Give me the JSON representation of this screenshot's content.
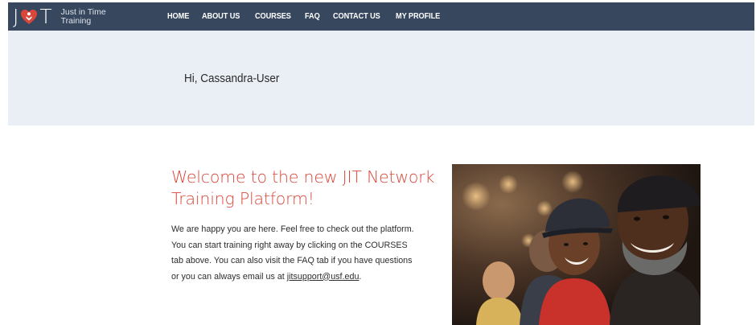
{
  "brand": {
    "logo_letter_left": "J",
    "logo_letter_right": "T",
    "name_line1": "Just in Time",
    "name_line2": "Training"
  },
  "nav": {
    "items": [
      {
        "label": "HOME"
      },
      {
        "label": "ABOUT US"
      },
      {
        "label": "COURSES"
      },
      {
        "label": "FAQ"
      },
      {
        "label": "CONTACT US"
      },
      {
        "label": "MY PROFILE"
      }
    ]
  },
  "greeting": "Hi, Cassandra-User",
  "welcome": {
    "title": "Welcome to the new JIT Network Training Platform!",
    "body_before_link": "We are happy you are here. Feel free to check out the platform. You can start training right away by clicking on the COURSES tab above. You can also visit the FAQ tab if you have questions or you can always email us at ",
    "email": "jitsupport@usf.edu",
    "body_after_link": "."
  },
  "colors": {
    "nav_background": "#36475e",
    "hero_background": "#eaeef5",
    "accent": "#d9473b"
  },
  "icons": {
    "logo": "heart-hand-icon",
    "photo": "stadium-fans-photo"
  }
}
